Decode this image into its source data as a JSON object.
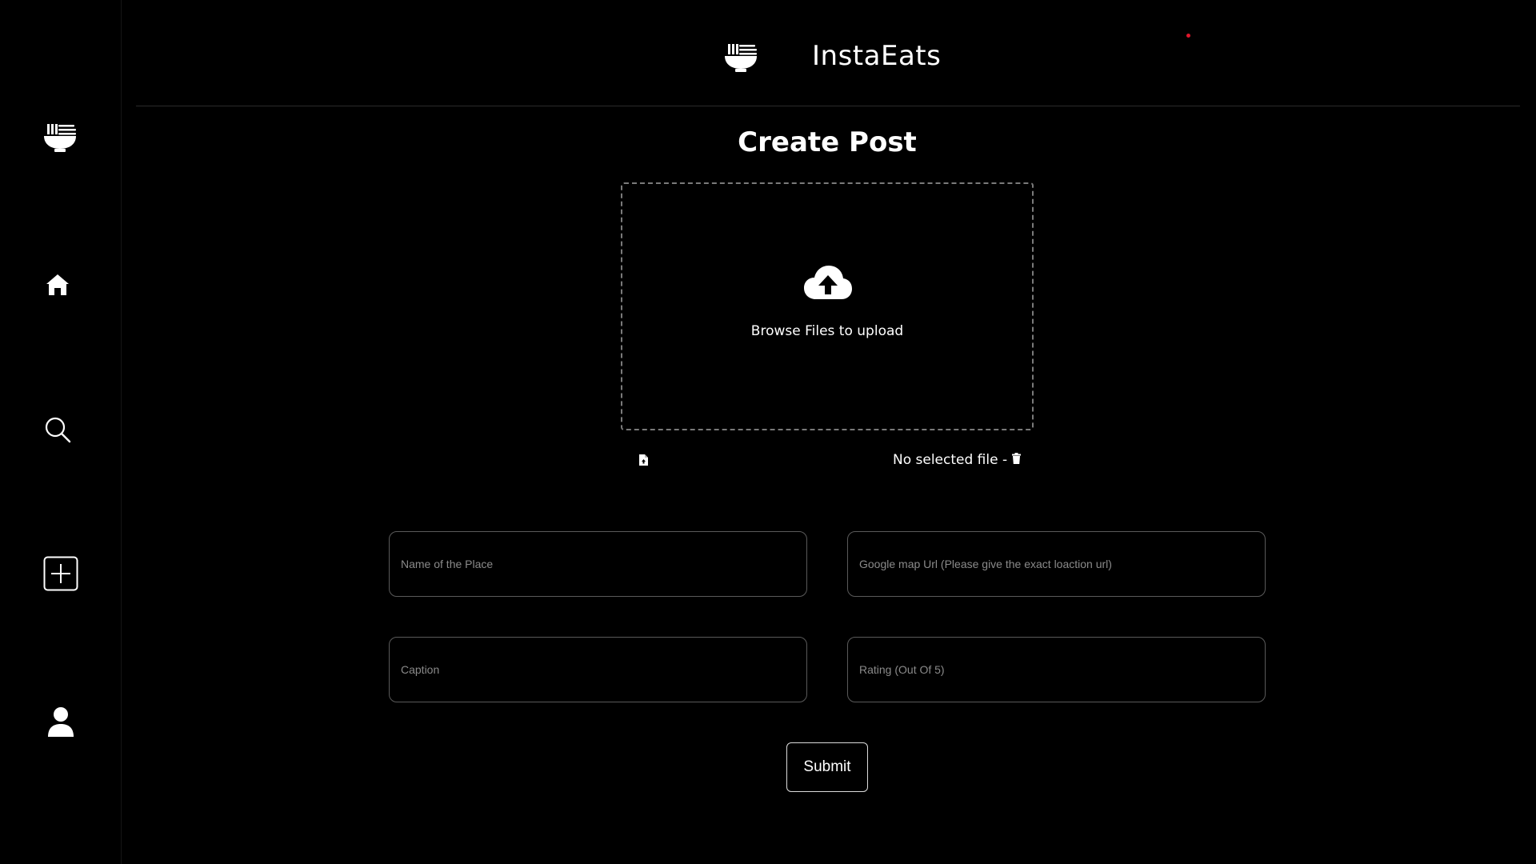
{
  "app": {
    "title": "InstaEats",
    "accent_color": "#e0162b",
    "logo_icon": "noodle-bowl-icon"
  },
  "sidebar": {
    "items": [
      {
        "name": "logo",
        "icon": "noodle-bowl-icon"
      },
      {
        "name": "home",
        "icon": "home-icon"
      },
      {
        "name": "search",
        "icon": "search-icon"
      },
      {
        "name": "create",
        "icon": "plus-square-icon"
      },
      {
        "name": "profile",
        "icon": "user-icon"
      }
    ]
  },
  "main": {
    "title": "Create Post",
    "upload": {
      "icon": "cloud-upload-icon",
      "label": "Browse Files to upload"
    },
    "file_status": "No selected file -",
    "fields": {
      "place_name": {
        "placeholder": "Name of the Place",
        "value": ""
      },
      "map_url": {
        "placeholder": "Google map Url (Please give the exact loaction url)",
        "value": ""
      },
      "caption": {
        "placeholder": "Caption",
        "value": ""
      },
      "rating": {
        "placeholder": "Rating (Out Of 5)",
        "value": ""
      }
    },
    "submit_label": "Submit"
  }
}
